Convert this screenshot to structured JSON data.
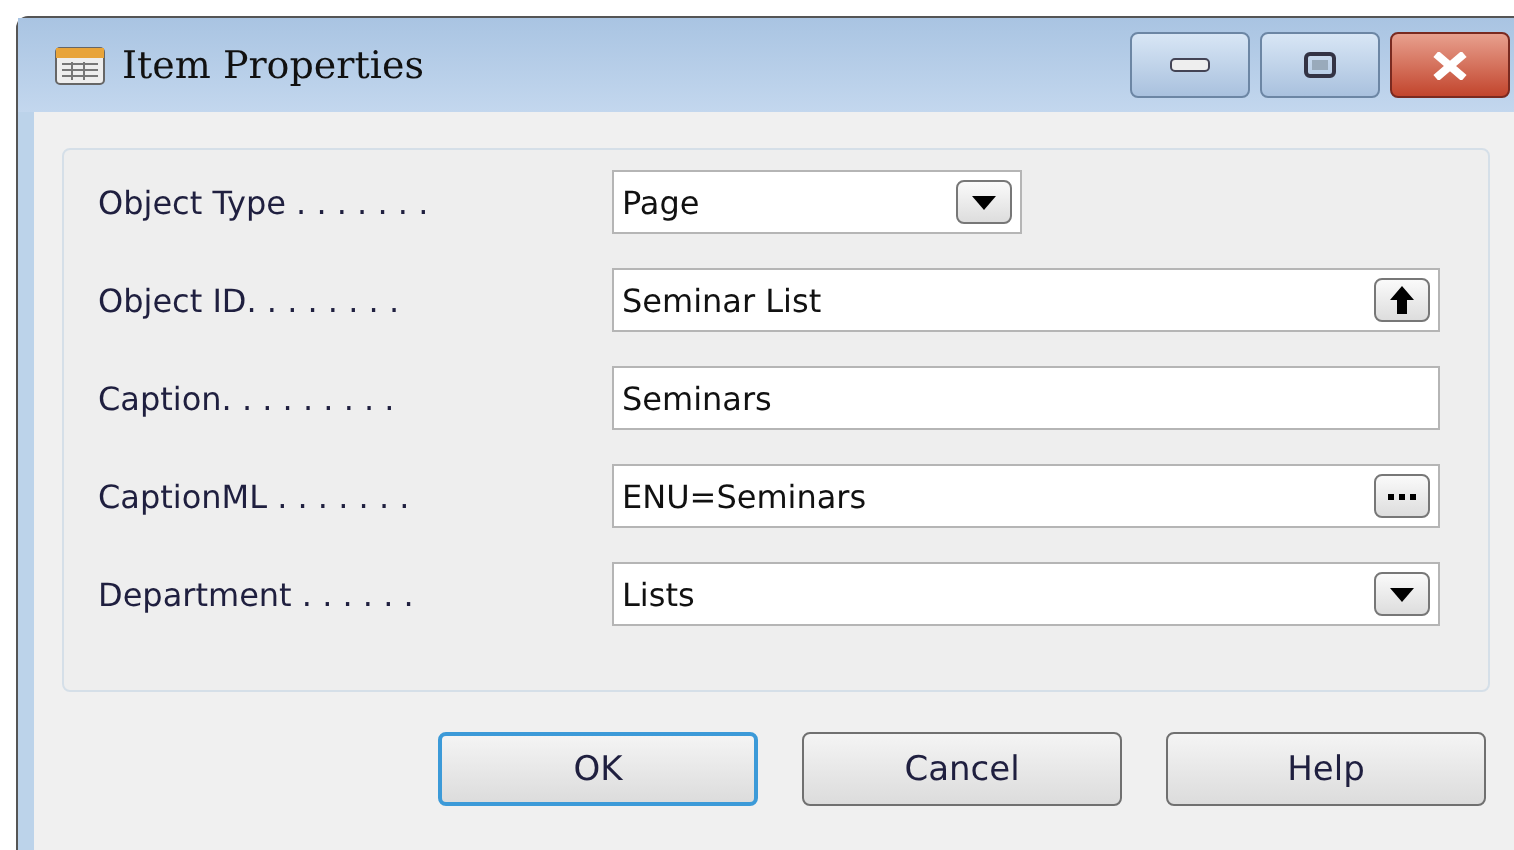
{
  "window": {
    "title": "Item Properties"
  },
  "fields": [
    {
      "label": "Object Type . . . . . . .",
      "value": "Page",
      "kind": "dropdown"
    },
    {
      "label": "Object ID. . . . . . . .",
      "value": "Seminar List",
      "kind": "lookup"
    },
    {
      "label": "Caption. . . . . . . . .",
      "value": "Seminars",
      "kind": "text"
    },
    {
      "label": "CaptionML . . . . . . .",
      "value": "ENU=Seminars",
      "kind": "assist"
    },
    {
      "label": "Department . . . . . .",
      "value": "Lists",
      "kind": "dropdown_wide"
    }
  ],
  "buttons": [
    {
      "label": "OK",
      "selected": true
    },
    {
      "label": "Cancel",
      "selected": false
    },
    {
      "label": "Help",
      "selected": false
    }
  ]
}
